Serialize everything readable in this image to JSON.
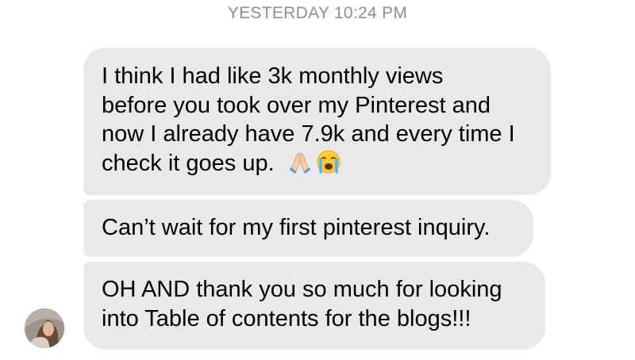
{
  "timestamp": "YESTERDAY 10:24 PM",
  "messages": [
    {
      "lines": [
        "I think I had like 3k monthly views",
        "before you took over my Pinterest and",
        "now I already have 7.9k and every time I",
        "check it goes up."
      ],
      "emojis": [
        "folded-hands-icon",
        "loudly-crying-face-icon"
      ]
    },
    {
      "lines": [
        "Can’t wait for my first pinterest inquiry."
      ]
    },
    {
      "lines": [
        "OH AND thank you so much for looking",
        "into Table of contents for the blogs!!!"
      ]
    }
  ],
  "colors": {
    "bubble_background": "#e9e9eb",
    "timestamp_text": "#8e8e93",
    "message_text": "#000000"
  }
}
